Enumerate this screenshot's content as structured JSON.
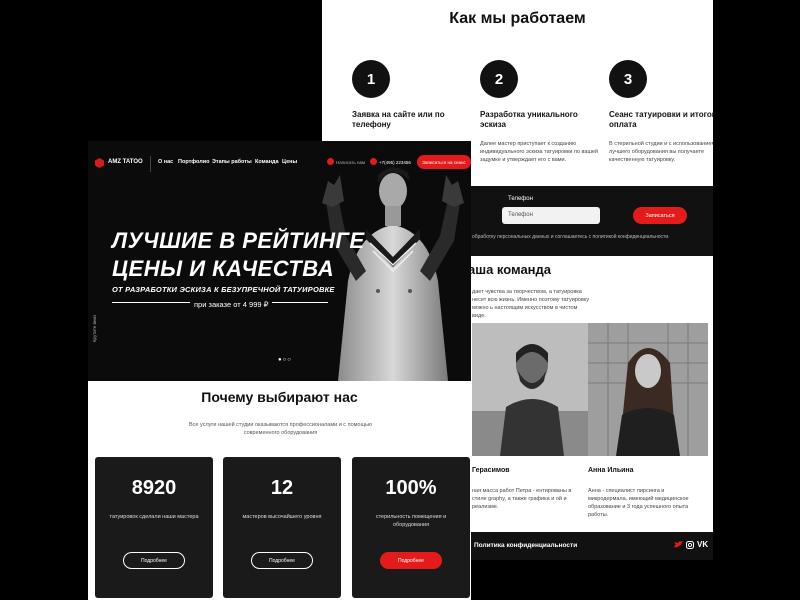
{
  "back": {
    "how_title": "Как мы работаем",
    "steps": [
      {
        "num": "1",
        "title": "Заявка на сайте или по телефону",
        "text": ""
      },
      {
        "num": "2",
        "title": "Разработка уникального эскиза",
        "text": "Далее мастер приступает к созданию индивидуального эскиза татуировки по вашей задумке и утверждает его с вами."
      },
      {
        "num": "3",
        "title": "Сеанс татуировки и итоговая оплата",
        "text": "В стерильной студии и с использованием лучшего оборудования вы получаете качественную татуировку."
      }
    ],
    "phone_label": "Телефон",
    "phone_placeholder": "Телефон",
    "send_label": "Записаться",
    "consent": "обработку персональных данных и соглашаетесь с политикой конфиденциальности.",
    "team_title": "аша команда",
    "team_text": "дает чувства за творчеством, а татуировка несет всю жизнь. Именно поэтому татуировку можно ь настоящим искусством в чистом виде.",
    "members": [
      {
        "name": "Герасимов",
        "text": "ная масса работ Петра - ентированы в стиле graphy, а также графика и ой и реализме."
      },
      {
        "name": "Анна Ильина",
        "text": "Анна - специалист пирсинга и микродермала, имеющий медицинское образование и 3 года успешного опыта работы."
      }
    ],
    "footer_link": "Политика конфиденциальности",
    "social": [
      "twitter-icon",
      "instagram-icon",
      "vk-icon"
    ]
  },
  "front": {
    "window_dots": "•••",
    "logo": "AMZ TATOO",
    "nav": [
      "О нас",
      "Портфолио",
      "Этапы работы",
      "Команда",
      "Цены"
    ],
    "write_us": "Написать нам",
    "phone": "+7(495) 223456",
    "signup": "Записаться на сеанс",
    "hero_title_1": "ЛУЧШИЕ В РЕЙТИНГЕ",
    "hero_title_2": "ЦЕНЫ И КАЧЕСТВА",
    "hero_sub": "ОТ РАЗРАБОТКИ ЭСКИЗА К БЕЗУПРЕЧНОЙ ТАТУИРОВКЕ",
    "hero_price": "при заказе от 4 999 ₽",
    "vertical": "Крутите вниз",
    "slider_dots": "●○○",
    "why_title": "Почему выбирают нас",
    "why_text": "Все услуги нашей студии оказываются профессионалами и с помощью современного оборудования",
    "cards": [
      {
        "num": "8920",
        "text": "татуировок сделали наши мастера",
        "btn": "Подробнее"
      },
      {
        "num": "12",
        "text": "мастеров высочайшего уровня",
        "btn": "Подробнее"
      },
      {
        "num": "100%",
        "text": "стерильность помещения и оборудования",
        "btn": "Подробнее"
      }
    ]
  },
  "colors": {
    "accent": "#e41b1b",
    "dark": "#0b0b0b"
  }
}
